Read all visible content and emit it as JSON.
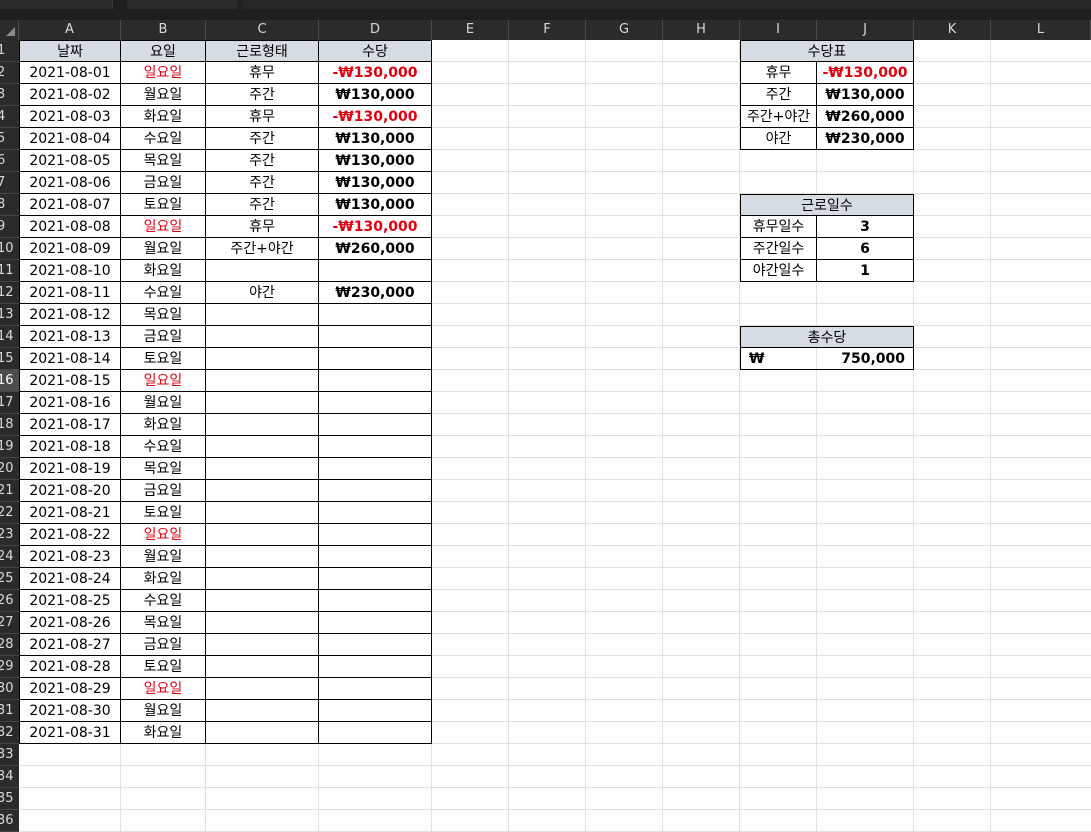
{
  "columns": [
    "A",
    "B",
    "C",
    "D",
    "E",
    "F",
    "G",
    "H",
    "I",
    "J",
    "K",
    "L"
  ],
  "row_numbers": [
    "1",
    "2",
    "3",
    "4",
    "5",
    "6",
    "7",
    "8",
    "9",
    "10",
    "11",
    "12",
    "13",
    "14",
    "15",
    "16",
    "17",
    "18",
    "19",
    "20",
    "21",
    "22",
    "23",
    "24",
    "25",
    "26",
    "27",
    "28",
    "29",
    "30",
    "31",
    "32",
    "33",
    "34",
    "35",
    "36"
  ],
  "selected_row": "16",
  "main_table": {
    "headers": [
      "날짜",
      "요일",
      "근로형태",
      "수당"
    ],
    "rows": [
      {
        "date": "2021-08-01",
        "day": "일요일",
        "type": "휴무",
        "pay": "-₩130,000",
        "sun": true,
        "neg": true
      },
      {
        "date": "2021-08-02",
        "day": "월요일",
        "type": "주간",
        "pay": "₩130,000"
      },
      {
        "date": "2021-08-03",
        "day": "화요일",
        "type": "휴무",
        "pay": "-₩130,000",
        "neg": true
      },
      {
        "date": "2021-08-04",
        "day": "수요일",
        "type": "주간",
        "pay": "₩130,000"
      },
      {
        "date": "2021-08-05",
        "day": "목요일",
        "type": "주간",
        "pay": "₩130,000"
      },
      {
        "date": "2021-08-06",
        "day": "금요일",
        "type": "주간",
        "pay": "₩130,000"
      },
      {
        "date": "2021-08-07",
        "day": "토요일",
        "type": "주간",
        "pay": "₩130,000"
      },
      {
        "date": "2021-08-08",
        "day": "일요일",
        "type": "휴무",
        "pay": "-₩130,000",
        "sun": true,
        "neg": true
      },
      {
        "date": "2021-08-09",
        "day": "월요일",
        "type": "주간+야간",
        "pay": "₩260,000"
      },
      {
        "date": "2021-08-10",
        "day": "화요일",
        "type": "",
        "pay": ""
      },
      {
        "date": "2021-08-11",
        "day": "수요일",
        "type": "야간",
        "pay": "₩230,000"
      },
      {
        "date": "2021-08-12",
        "day": "목요일",
        "type": "",
        "pay": ""
      },
      {
        "date": "2021-08-13",
        "day": "금요일",
        "type": "",
        "pay": ""
      },
      {
        "date": "2021-08-14",
        "day": "토요일",
        "type": "",
        "pay": ""
      },
      {
        "date": "2021-08-15",
        "day": "일요일",
        "type": "",
        "pay": "",
        "sun": true
      },
      {
        "date": "2021-08-16",
        "day": "월요일",
        "type": "",
        "pay": ""
      },
      {
        "date": "2021-08-17",
        "day": "화요일",
        "type": "",
        "pay": ""
      },
      {
        "date": "2021-08-18",
        "day": "수요일",
        "type": "",
        "pay": ""
      },
      {
        "date": "2021-08-19",
        "day": "목요일",
        "type": "",
        "pay": ""
      },
      {
        "date": "2021-08-20",
        "day": "금요일",
        "type": "",
        "pay": ""
      },
      {
        "date": "2021-08-21",
        "day": "토요일",
        "type": "",
        "pay": ""
      },
      {
        "date": "2021-08-22",
        "day": "일요일",
        "type": "",
        "pay": "",
        "sun": true
      },
      {
        "date": "2021-08-23",
        "day": "월요일",
        "type": "",
        "pay": ""
      },
      {
        "date": "2021-08-24",
        "day": "화요일",
        "type": "",
        "pay": ""
      },
      {
        "date": "2021-08-25",
        "day": "수요일",
        "type": "",
        "pay": ""
      },
      {
        "date": "2021-08-26",
        "day": "목요일",
        "type": "",
        "pay": ""
      },
      {
        "date": "2021-08-27",
        "day": "금요일",
        "type": "",
        "pay": ""
      },
      {
        "date": "2021-08-28",
        "day": "토요일",
        "type": "",
        "pay": ""
      },
      {
        "date": "2021-08-29",
        "day": "일요일",
        "type": "",
        "pay": "",
        "sun": true
      },
      {
        "date": "2021-08-30",
        "day": "월요일",
        "type": "",
        "pay": ""
      },
      {
        "date": "2021-08-31",
        "day": "화요일",
        "type": "",
        "pay": ""
      }
    ]
  },
  "allowance_table": {
    "title": "수당표",
    "rows": [
      {
        "label": "휴무",
        "value": "-₩130,000",
        "neg": true
      },
      {
        "label": "주간",
        "value": "₩130,000"
      },
      {
        "label": "주간+야간",
        "value": "₩260,000"
      },
      {
        "label": "야간",
        "value": "₩230,000"
      }
    ]
  },
  "workdays_table": {
    "title": "근로일수",
    "rows": [
      {
        "label": "휴무일수",
        "value": "3"
      },
      {
        "label": "주간일수",
        "value": "6"
      },
      {
        "label": "야간일수",
        "value": "1"
      }
    ]
  },
  "total_table": {
    "title": "총수당",
    "currency": "₩",
    "value": "750,000"
  },
  "colors": {
    "header_fill": "#d6dce4",
    "negative": "#e0000f",
    "sunday": "#e0000f",
    "chrome": "#2b2b2b"
  }
}
